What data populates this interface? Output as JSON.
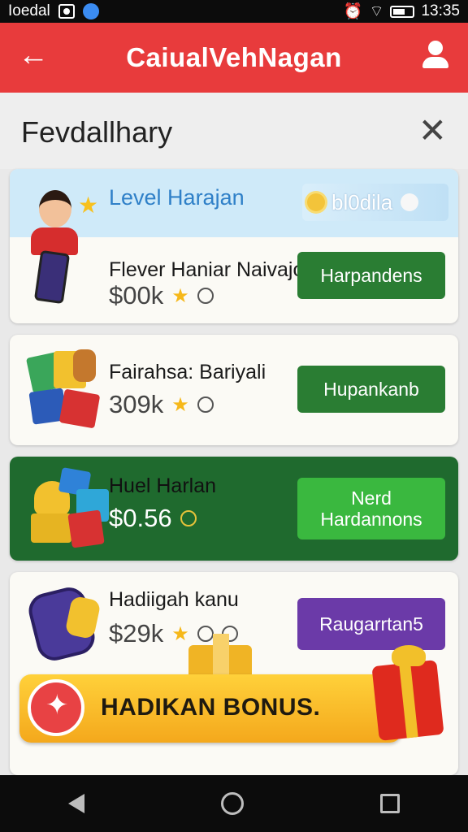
{
  "status_bar": {
    "carrier": "Ioedal",
    "time": "13:35"
  },
  "app_bar": {
    "title": "CaiualVehNagan"
  },
  "sheet": {
    "title": "Fevdallhary"
  },
  "featured": {
    "banner_label": "Level Harajan",
    "coin_label": "bl0dila"
  },
  "offers": [
    {
      "name": "Flever Haniar Naivajon",
      "price": "$00k",
      "button": "Harpandens"
    },
    {
      "name": "Fairahsa: Bariyali",
      "price": "309k",
      "button": "Hupankanb"
    },
    {
      "name": "Huel Harlan",
      "price": "$0.56",
      "button_line1": "Nerd",
      "button_line2": "Hardannons"
    },
    {
      "name": "Hadiigah kanu",
      "price": "$29k",
      "button": "Raugarrtan5"
    }
  ],
  "bonus": {
    "text": "HADIKAN BONUS."
  },
  "colors": {
    "app_bar": "#e83b3c",
    "button_green": "#2a7d33",
    "button_bright_green": "#3ab83f",
    "button_purple": "#6b3aa8",
    "highlight_card": "#1f6a2e",
    "bonus_yellow": "#ffd13a"
  }
}
